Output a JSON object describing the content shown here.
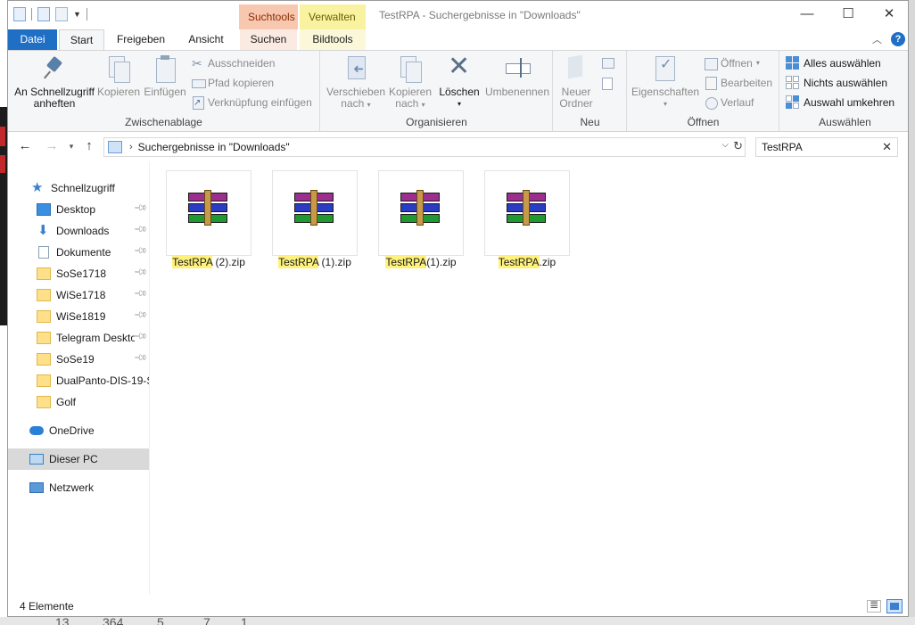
{
  "window": {
    "title": "TestRPA - Suchergebnisse in \"Downloads\"",
    "controls": {
      "minimize": "—",
      "maximize": "☐",
      "close": "✕"
    }
  },
  "context_tabs": {
    "suchtools": "Suchtools",
    "verwalten": "Verwalten"
  },
  "tabs": {
    "datei": "Datei",
    "start": "Start",
    "freigeben": "Freigeben",
    "ansicht": "Ansicht",
    "suchen": "Suchen",
    "bildtools": "Bildtools",
    "help": "?"
  },
  "ribbon": {
    "zwischenablage": {
      "label": "Zwischenablage",
      "pin_line1": "An Schnellzugriff",
      "pin_line2": "anheften",
      "copy": "Kopieren",
      "paste": "Einfügen",
      "cut": "Ausschneiden",
      "copy_path": "Pfad kopieren",
      "paste_shortcut": "Verknüpfung einfügen"
    },
    "organisieren": {
      "label": "Organisieren",
      "move_line1": "Verschieben",
      "move_line2": "nach",
      "copyto_line1": "Kopieren",
      "copyto_line2": "nach",
      "delete": "Löschen",
      "rename": "Umbenennen"
    },
    "neu": {
      "label": "Neu",
      "new_folder_line1": "Neuer",
      "new_folder_line2": "Ordner"
    },
    "oeffnen": {
      "label": "Öffnen",
      "properties": "Eigenschaften",
      "open": "Öffnen",
      "edit": "Bearbeiten",
      "history": "Verlauf"
    },
    "auswaehlen": {
      "label": "Auswählen",
      "select_all": "Alles auswählen",
      "select_none": "Nichts auswählen",
      "invert": "Auswahl umkehren"
    }
  },
  "address": {
    "crumb": "Suchergebnisse in \"Downloads\"",
    "search_value": "TestRPA"
  },
  "nav": {
    "quick_access": "Schnellzugriff",
    "items": [
      {
        "label": "Desktop"
      },
      {
        "label": "Downloads"
      },
      {
        "label": "Dokumente"
      },
      {
        "label": "SoSe1718"
      },
      {
        "label": "WiSe1718"
      },
      {
        "label": "WiSe1819"
      },
      {
        "label": "Telegram Desktop"
      },
      {
        "label": "SoSe19"
      },
      {
        "label": "DualPanto-DIS-19-S"
      },
      {
        "label": "Golf"
      }
    ],
    "onedrive": "OneDrive",
    "this_pc": "Dieser PC",
    "network": "Netzwerk"
  },
  "files": [
    {
      "match": "TestRPA",
      "rest": " (2).zip"
    },
    {
      "match": "TestRPA",
      "rest": " (1).zip"
    },
    {
      "match": "TestRPA",
      "rest": "(1).zip"
    },
    {
      "match": "TestRPA",
      "rest": ".zip"
    }
  ],
  "status": {
    "count": "4 Elemente"
  },
  "background": {
    "bottom_numbers": [
      "13",
      "364",
      "5",
      "7",
      "1"
    ]
  }
}
